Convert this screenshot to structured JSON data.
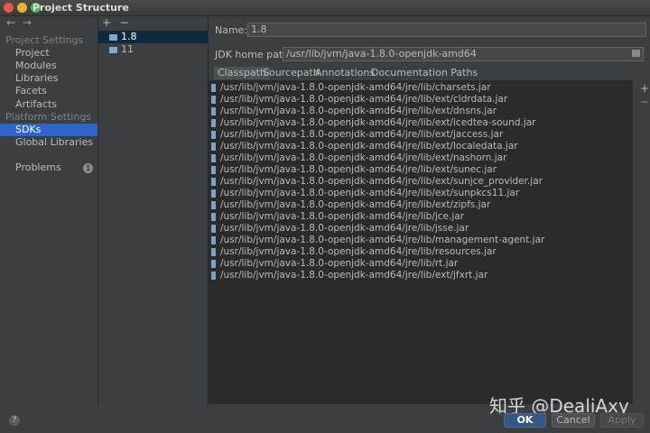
{
  "window": {
    "title": "Project Structure"
  },
  "nav": {
    "back": "←",
    "forward": "→"
  },
  "sidebar": {
    "section_project": "Project Settings",
    "project_items": [
      "Project",
      "Modules",
      "Libraries",
      "Facets",
      "Artifacts"
    ],
    "section_platform": "Platform Settings",
    "platform_items": [
      "SDKs",
      "Global Libraries"
    ],
    "selected": "SDKs",
    "problems_label": "Problems",
    "problems_count": "1"
  },
  "sdk_list": {
    "add": "+",
    "remove": "−",
    "items": [
      "1.8",
      "11"
    ],
    "selected": "1.8"
  },
  "details": {
    "name_label": "Name:",
    "name_value": "1.8",
    "home_label": "JDK home path:",
    "home_value": "/usr/lib/jvm/java-1.8.0-openjdk-amd64",
    "tabs": [
      "Classpath",
      "Sourcepath",
      "Annotations",
      "Documentation Paths"
    ],
    "active_tab": "Classpath",
    "side_add": "+",
    "side_remove": "−",
    "classpath": [
      "/usr/lib/jvm/java-1.8.0-openjdk-amd64/jre/lib/charsets.jar",
      "/usr/lib/jvm/java-1.8.0-openjdk-amd64/jre/lib/ext/cldrdata.jar",
      "/usr/lib/jvm/java-1.8.0-openjdk-amd64/jre/lib/ext/dnsns.jar",
      "/usr/lib/jvm/java-1.8.0-openjdk-amd64/jre/lib/ext/icedtea-sound.jar",
      "/usr/lib/jvm/java-1.8.0-openjdk-amd64/jre/lib/ext/jaccess.jar",
      "/usr/lib/jvm/java-1.8.0-openjdk-amd64/jre/lib/ext/localedata.jar",
      "/usr/lib/jvm/java-1.8.0-openjdk-amd64/jre/lib/ext/nashorn.jar",
      "/usr/lib/jvm/java-1.8.0-openjdk-amd64/jre/lib/ext/sunec.jar",
      "/usr/lib/jvm/java-1.8.0-openjdk-amd64/jre/lib/ext/sunjce_provider.jar",
      "/usr/lib/jvm/java-1.8.0-openjdk-amd64/jre/lib/ext/sunpkcs11.jar",
      "/usr/lib/jvm/java-1.8.0-openjdk-amd64/jre/lib/ext/zipfs.jar",
      "/usr/lib/jvm/java-1.8.0-openjdk-amd64/jre/lib/jce.jar",
      "/usr/lib/jvm/java-1.8.0-openjdk-amd64/jre/lib/jsse.jar",
      "/usr/lib/jvm/java-1.8.0-openjdk-amd64/jre/lib/management-agent.jar",
      "/usr/lib/jvm/java-1.8.0-openjdk-amd64/jre/lib/resources.jar",
      "/usr/lib/jvm/java-1.8.0-openjdk-amd64/jre/lib/rt.jar",
      "/usr/lib/jvm/java-1.8.0-openjdk-amd64/jre/lib/ext/jfxrt.jar"
    ]
  },
  "footer": {
    "help": "?",
    "ok": "OK",
    "cancel": "Cancel",
    "apply": "Apply",
    "watermark": "知乎 @DealiAxy"
  },
  "colors": {
    "background": "#3c3f41",
    "list_background": "#2b2b2b",
    "selection": "#2f65ca",
    "sdk_selection": "#0d293e",
    "ok_button": "#365880"
  },
  "icons": {
    "window_close": "traffic-light-red",
    "window_minimize": "traffic-light-yellow",
    "window_maximize": "traffic-light-green",
    "sdk": "folder-icon",
    "classpath_entry": "jar-icon",
    "browse": "folder-icon"
  }
}
